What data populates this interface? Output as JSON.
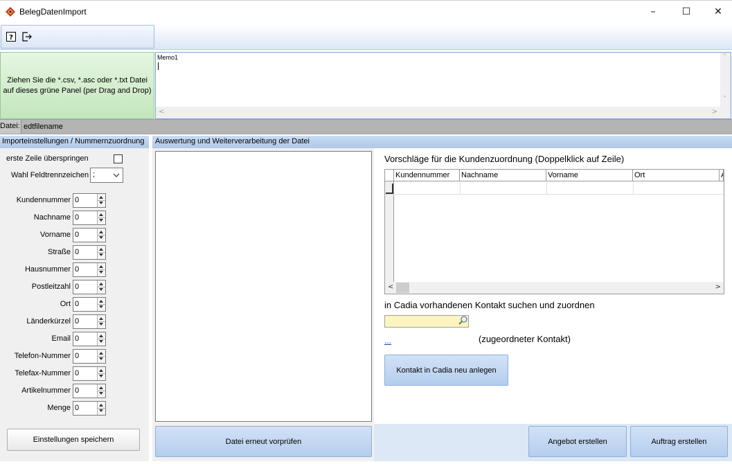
{
  "window": {
    "title": "BelegDatenImport",
    "minimize": "–",
    "maximize": "☐",
    "close": "✕"
  },
  "toolbar": {
    "help_icon": "help-icon",
    "exit_icon": "exit-icon"
  },
  "drop_panel": {
    "text": "Ziehen Sie die *.csv, *.asc oder *.txt Datei auf dieses grüne Panel (per Drag and Drop)"
  },
  "memo": {
    "text": "Memo1"
  },
  "file": {
    "label": "Datei:",
    "value": "edtfilename"
  },
  "left": {
    "header": "Importeinstellungen / Nummernzuordnung",
    "skip_first_row": "erste Zeile überspringen",
    "separator_label": "Wahl Feldtrennzeichen",
    "separator_value": ";",
    "fields": [
      {
        "label": "Kundennummer",
        "value": "0"
      },
      {
        "label": "Nachname",
        "value": "0"
      },
      {
        "label": "Vorname",
        "value": "0"
      },
      {
        "label": "Straße",
        "value": "0"
      },
      {
        "label": "Hausnummer",
        "value": "0"
      },
      {
        "label": "Postleitzahl",
        "value": "0"
      },
      {
        "label": "Ort",
        "value": "0"
      },
      {
        "label": "Länderkürzel",
        "value": "0"
      },
      {
        "label": "Email",
        "value": "0"
      },
      {
        "label": "Telefon-Nummer",
        "value": "0"
      },
      {
        "label": "Telefax-Nummer",
        "value": "0"
      },
      {
        "label": "Artikelnummer",
        "value": "0"
      },
      {
        "label": "Menge",
        "value": "0"
      }
    ],
    "save_button": "Einstellungen speichern"
  },
  "right": {
    "header": "Auswertung und Weiterverarbeitung der Datei",
    "suggest_title": "Vorschläge für die Kundenzuordnung (Doppelklick auf Zeile)",
    "grid_columns": [
      "Kundennummer",
      "Nachname",
      "Vorname",
      "Ort",
      "A"
    ],
    "search_title": "in Cadia vorhandenen Kontakt suchen und zuordnen",
    "assigned_link": "...",
    "assigned_label": "(zugeordneter Kontakt)",
    "new_contact_button": "Kontakt in Cadia neu anlegen",
    "recheck_button": "Datei erneut vorprüfen",
    "offer_button": "Angebot erstellen",
    "order_button": "Auftrag erstellen"
  },
  "colors": {
    "accent_blue": "#b4cdee",
    "drop_green": "#c3e6bd",
    "search_yellow": "#fdf5c0"
  }
}
